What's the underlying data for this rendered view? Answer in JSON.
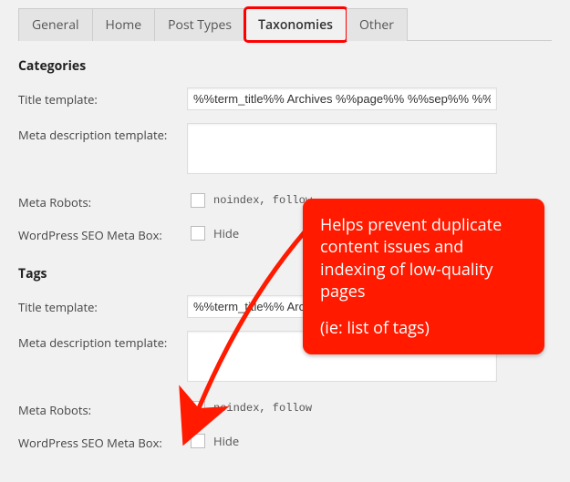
{
  "tabs": {
    "general": "General",
    "home": "Home",
    "post_types": "Post Types",
    "taxonomies": "Taxonomies",
    "other": "Other"
  },
  "categories": {
    "heading": "Categories",
    "title_label": "Title template:",
    "title_value": "%%term_title%% Archives %%page%% %%sep%% %%sitena",
    "meta_desc_label": "Meta description template:",
    "meta_desc_value": "",
    "robots_label": "Meta Robots:",
    "robots_value": "noindex, follow",
    "robots_checked": false,
    "box_label": "WordPress SEO Meta Box:",
    "box_value": "Hide",
    "box_checked": false
  },
  "tags": {
    "heading": "Tags",
    "title_label": "Title template:",
    "title_value": "%%term_title%% Archives %%page%% %%sep%% %%sitena",
    "meta_desc_label": "Meta description template:",
    "meta_desc_value": "",
    "robots_label": "Meta Robots:",
    "robots_value": "noindex, follow",
    "robots_checked": true,
    "box_label": "WordPress SEO Meta Box:",
    "box_value": "Hide",
    "box_checked": false
  },
  "annotation": {
    "line1": "Helps prevent duplicate content issues and indexing of low-quality pages",
    "line2": "(ie: list of tags)"
  }
}
